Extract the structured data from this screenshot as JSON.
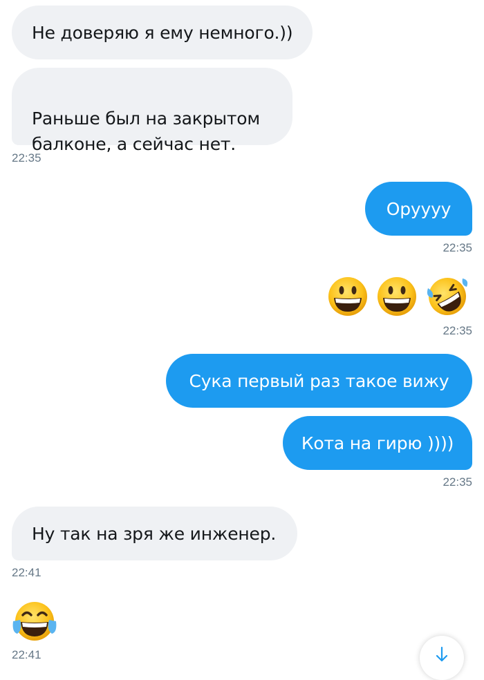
{
  "messages": {
    "m1": {
      "text": "Не доверяю я ему немного.))"
    },
    "m2": {
      "text": "Раньше был на закрытом\nбалконе, а сейчас нет.",
      "time": "22:35"
    },
    "m3": {
      "text": "Оруууу",
      "time": "22:35"
    },
    "m4": {
      "emojis": [
        "grinning-face",
        "grinning-face",
        "rolling-on-floor-laughing"
      ],
      "time": "22:35"
    },
    "m5": {
      "text": "Сука первый раз такое вижу"
    },
    "m6": {
      "text": "Кота на гирю ))))",
      "time": "22:35"
    },
    "m7": {
      "text": "Ну так на зря же инженер.",
      "time": "22:41"
    },
    "m8": {
      "emojis": [
        "face-with-tears-of-joy"
      ],
      "time": "22:41"
    }
  },
  "scroll_button": {
    "icon": "arrow-down-icon"
  },
  "colors": {
    "incoming_bubble": "#eff1f4",
    "outgoing_bubble": "#1d9bf0",
    "timestamp": "#657786"
  }
}
